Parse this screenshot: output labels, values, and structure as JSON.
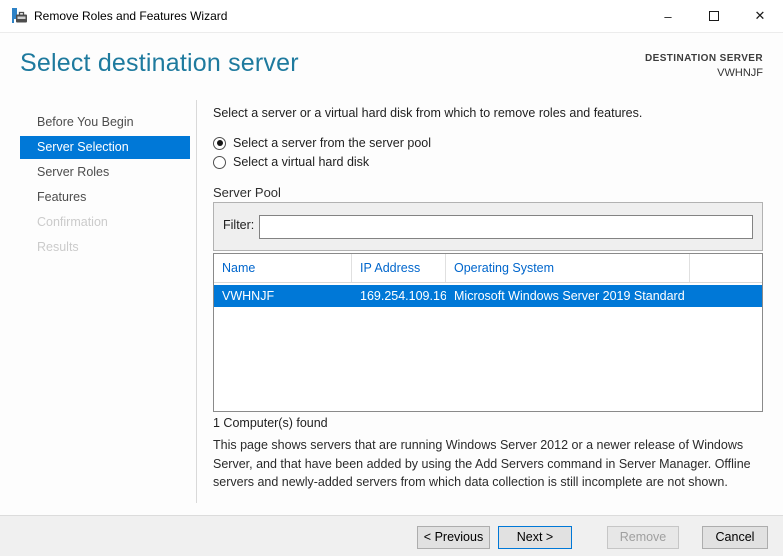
{
  "window": {
    "title": "Remove Roles and Features Wizard",
    "controls": {
      "minimize": "–",
      "close": "✕"
    }
  },
  "header": {
    "title": "Select destination server",
    "destination_label": "DESTINATION SERVER",
    "destination_value": "VWHNJF"
  },
  "sidebar": {
    "items": [
      {
        "label": "Before You Begin",
        "state": "enabled"
      },
      {
        "label": "Server Selection",
        "state": "selected"
      },
      {
        "label": "Server Roles",
        "state": "enabled"
      },
      {
        "label": "Features",
        "state": "enabled"
      },
      {
        "label": "Confirmation",
        "state": "disabled"
      },
      {
        "label": "Results",
        "state": "disabled"
      }
    ]
  },
  "main": {
    "intro": "Select a server or a virtual hard disk from which to remove roles and features.",
    "radio_server_pool": "Select a server from the server pool",
    "radio_vhd": "Select a virtual hard disk",
    "radio_selected": "server_pool"
  },
  "server_pool": {
    "title": "Server Pool",
    "filter_label": "Filter:",
    "filter_value": "",
    "table": {
      "columns": [
        "Name",
        "IP Address",
        "Operating System"
      ],
      "rows": [
        {
          "name": "VWHNJF",
          "ip": "169.254.109.16...",
          "os": "Microsoft Windows Server 2019 Standard",
          "selected": true
        }
      ]
    },
    "count_text": "1 Computer(s) found"
  },
  "description": "This page shows servers that are running Windows Server 2012 or a newer release of Windows Server, and that have been added by using the Add Servers command in Server Manager. Offline servers and newly-added servers from which data collection is still incomplete are not shown.",
  "footer": {
    "buttons": [
      {
        "label": "< Previous",
        "state": "enabled"
      },
      {
        "label": "Next >",
        "state": "default"
      },
      {
        "label": "Remove",
        "state": "disabled"
      },
      {
        "label": "Cancel",
        "state": "enabled"
      }
    ]
  },
  "colors": {
    "accent": "#0078d7",
    "heading": "#1e7a9e",
    "table_header_text": "#0066cc",
    "footer_bg": "#f0f0f0"
  }
}
